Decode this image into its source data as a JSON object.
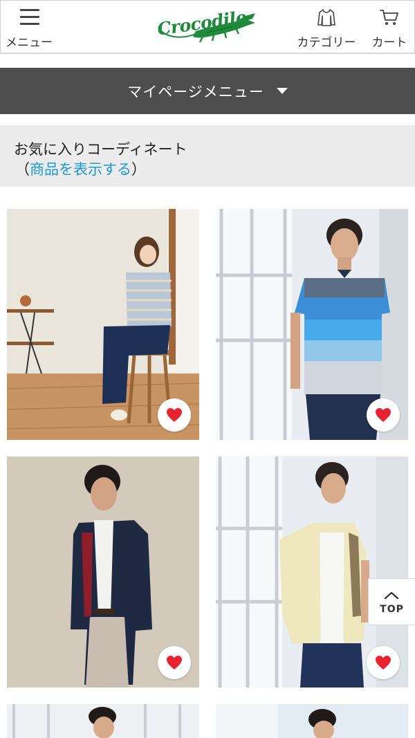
{
  "header": {
    "menu_label": "メニュー",
    "logo_text": "Crocodile",
    "category_label": "カテゴリー",
    "cart_label": "カート",
    "brand_color": "#1f8a3b"
  },
  "mypage_menu": {
    "label": "マイページメニュー",
    "icon": "triangle-down-icon"
  },
  "favorites": {
    "title": "お気に入りコーディネート",
    "paren_open": "（",
    "link_text": "商品を表示する",
    "paren_close": "）",
    "link_color": "#1a9ad6"
  },
  "cards": [
    {
      "subject": "woman-striped-top-on-stool",
      "favorited": true
    },
    {
      "subject": "man-blue-striped-polo",
      "favorited": true
    },
    {
      "subject": "man-navy-jacket",
      "favorited": true
    },
    {
      "subject": "man-beige-jacket",
      "favorited": true
    },
    {
      "subject": "man-coordinate-5",
      "favorited": true
    },
    {
      "subject": "man-coordinate-6",
      "favorited": true
    }
  ],
  "scroll_top": {
    "label": "TOP",
    "icon": "chevron-up-icon"
  },
  "accent_heart_color": "#e8232f"
}
